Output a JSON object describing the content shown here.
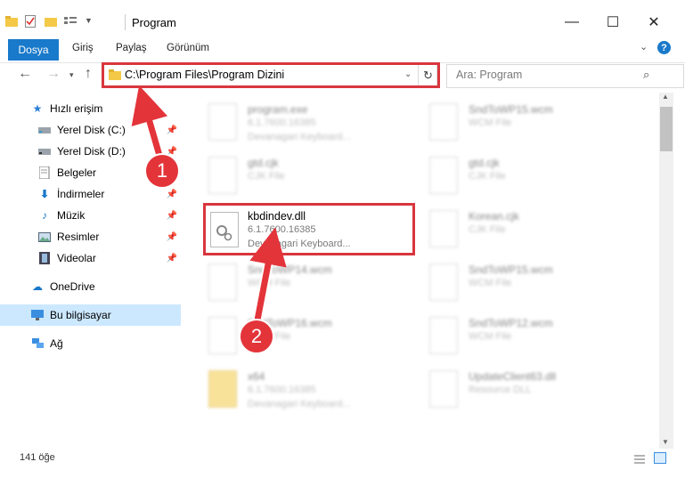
{
  "window": {
    "title": "Program",
    "minimize_glyph": "—",
    "maximize_glyph": "☐",
    "close_glyph": "✕"
  },
  "ribbon": {
    "tabs": [
      "Dosya",
      "Giriş",
      "Paylaş",
      "Görünüm"
    ]
  },
  "address_bar": {
    "path": "C:\\Program Files\\Program Dizini"
  },
  "search": {
    "placeholder": "Ara: Program"
  },
  "sidebar": {
    "quick_access": "Hızlı erişim",
    "items": [
      {
        "label": "Yerel Disk (C:)",
        "icon": "drive-icon"
      },
      {
        "label": "Yerel Disk (D:)",
        "icon": "drive-icon"
      },
      {
        "label": "Belgeler",
        "icon": "documents-icon"
      },
      {
        "label": "İndirmeler",
        "icon": "download-icon"
      },
      {
        "label": "Müzik",
        "icon": "music-icon"
      },
      {
        "label": "Resimler",
        "icon": "pictures-icon"
      },
      {
        "label": "Videolar",
        "icon": "video-icon"
      }
    ],
    "onedrive": "OneDrive",
    "this_pc": "Bu bilgisayar",
    "network": "Ağ"
  },
  "files": {
    "left": [
      {
        "name": "program.exe",
        "line2": "6.1.7600.16385",
        "line3": "Devanagari Keyboard..."
      },
      {
        "name": "gtd.cjk",
        "line2": "CJK File",
        "line3": ""
      },
      {
        "name": "kbdindev.dll",
        "line2": "6.1.7600.16385",
        "line3": "Devanagari Keyboard..."
      },
      {
        "name": "SndToWP14.wcm",
        "line2": "WCM File",
        "line3": ""
      },
      {
        "name": "SndToWP16.wcm",
        "line2": "WCM File",
        "line3": ""
      },
      {
        "name": "x64",
        "line2": "6.1.7600.16385",
        "line3": "Devanagari Keyboard..."
      }
    ],
    "right": [
      {
        "name": "SndToWP15.wcm",
        "line2": "WCM File",
        "line3": ""
      },
      {
        "name": "gtd.cjk",
        "line2": "CJK File",
        "line3": ""
      },
      {
        "name": "Korean.cjk",
        "line2": "CJK File",
        "line3": ""
      },
      {
        "name": "SndToWP15.wcm",
        "line2": "WCM File",
        "line3": ""
      },
      {
        "name": "SndToWP12.wcm",
        "line2": "WCM File",
        "line3": ""
      },
      {
        "name": "UpdateClient63.dll",
        "line2": "Resource DLL",
        "line3": ""
      }
    ]
  },
  "status": {
    "count": "141 öğe"
  },
  "markers": {
    "one": "1",
    "two": "2"
  },
  "colors": {
    "accent": "#1979ca",
    "highlight": "#d9363e",
    "selected": "#cce8ff"
  }
}
